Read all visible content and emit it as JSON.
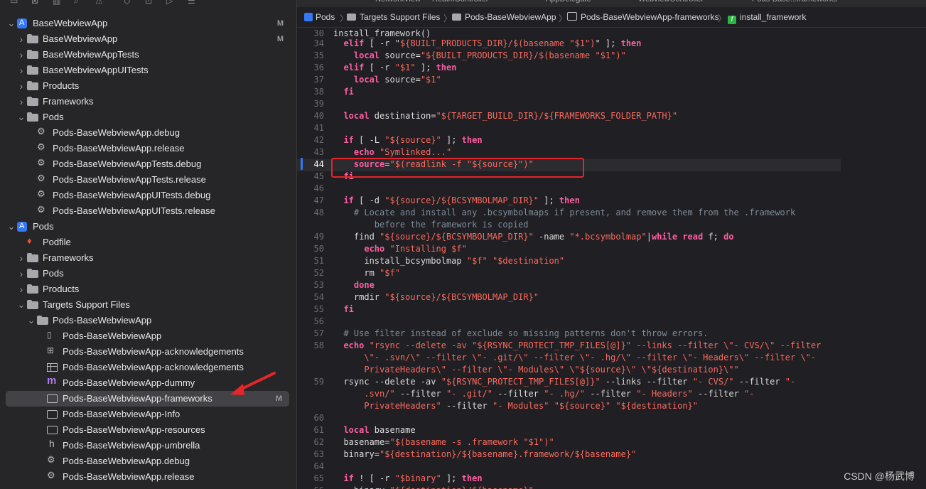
{
  "top_partial": {
    "tabs": [
      "NetworkView",
      "RealmController",
      "AppDelegate",
      "WebviewController",
      "Pods-Base...frameworks"
    ]
  },
  "navigator": {
    "items": [
      {
        "label": "BaseWebviewApp",
        "depth": 0,
        "kind": "project",
        "expanded": true,
        "badge": "M"
      },
      {
        "label": "BaseWebviewApp",
        "depth": 1,
        "kind": "folder",
        "expanded": false,
        "badge": "M"
      },
      {
        "label": "BaseWebviewAppTests",
        "depth": 1,
        "kind": "folder",
        "expanded": false
      },
      {
        "label": "BaseWebviewAppUITests",
        "depth": 1,
        "kind": "folder",
        "expanded": false
      },
      {
        "label": "Products",
        "depth": 1,
        "kind": "folder",
        "expanded": false
      },
      {
        "label": "Frameworks",
        "depth": 1,
        "kind": "folder",
        "expanded": false
      },
      {
        "label": "Pods",
        "depth": 1,
        "kind": "folder",
        "expanded": true
      },
      {
        "label": "Pods-BaseWebviewApp.debug",
        "depth": 2,
        "kind": "xcconfig"
      },
      {
        "label": "Pods-BaseWebviewApp.release",
        "depth": 2,
        "kind": "xcconfig"
      },
      {
        "label": "Pods-BaseWebviewAppTests.debug",
        "depth": 2,
        "kind": "xcconfig"
      },
      {
        "label": "Pods-BaseWebviewAppTests.release",
        "depth": 2,
        "kind": "xcconfig"
      },
      {
        "label": "Pods-BaseWebviewAppUITests.debug",
        "depth": 2,
        "kind": "xcconfig"
      },
      {
        "label": "Pods-BaseWebviewAppUITests.release",
        "depth": 2,
        "kind": "xcconfig"
      },
      {
        "label": "Pods",
        "depth": 0,
        "kind": "project",
        "expanded": true
      },
      {
        "label": "Podfile",
        "depth": 1,
        "kind": "podfile"
      },
      {
        "label": "Frameworks",
        "depth": 1,
        "kind": "folder",
        "expanded": false
      },
      {
        "label": "Pods",
        "depth": 1,
        "kind": "folder",
        "expanded": false
      },
      {
        "label": "Products",
        "depth": 1,
        "kind": "folder",
        "expanded": false
      },
      {
        "label": "Targets Support Files",
        "depth": 1,
        "kind": "folder",
        "expanded": true
      },
      {
        "label": "Pods-BaseWebviewApp",
        "depth": 2,
        "kind": "folder",
        "expanded": true
      },
      {
        "label": "Pods-BaseWebviewApp",
        "depth": 3,
        "kind": "modulemap"
      },
      {
        "label": "Pods-BaseWebviewApp-acknowledgements",
        "depth": 3,
        "kind": "markdown"
      },
      {
        "label": "Pods-BaseWebviewApp-acknowledgements",
        "depth": 3,
        "kind": "plist"
      },
      {
        "label": "Pods-BaseWebviewApp-dummy",
        "depth": 3,
        "kind": "objc"
      },
      {
        "label": "Pods-BaseWebviewApp-frameworks",
        "depth": 3,
        "kind": "script",
        "selected": true,
        "badge": "M"
      },
      {
        "label": "Pods-BaseWebviewApp-Info",
        "depth": 3,
        "kind": "script"
      },
      {
        "label": "Pods-BaseWebviewApp-resources",
        "depth": 3,
        "kind": "script"
      },
      {
        "label": "Pods-BaseWebviewApp-umbrella",
        "depth": 3,
        "kind": "header"
      },
      {
        "label": "Pods-BaseWebviewApp.debug",
        "depth": 3,
        "kind": "xcconfig"
      },
      {
        "label": "Pods-BaseWebviewApp.release",
        "depth": 3,
        "kind": "xcconfig"
      }
    ]
  },
  "jumpbar": {
    "crumbs": [
      "Pods",
      "Targets Support Files",
      "Pods-BaseWebviewApp",
      "Pods-BaseWebviewApp-frameworks",
      "install_framework"
    ]
  },
  "editor": {
    "sticky": {
      "num": "30",
      "text": "install_framework()"
    },
    "current_line": "44",
    "lines": [
      {
        "num": "34",
        "segs": [
          [
            "",
            "  "
          ],
          [
            "kw",
            "elif"
          ],
          [
            "",
            " [ -r \""
          ],
          [
            "str",
            "${BUILT_PRODUCTS_DIR}/$(basename \"$1\")"
          ],
          [
            "",
            "\" ]; "
          ],
          [
            "kw",
            "then"
          ]
        ]
      },
      {
        "num": "35",
        "segs": [
          [
            "",
            "    "
          ],
          [
            "kw",
            "local"
          ],
          [
            "",
            " source="
          ],
          [
            "str",
            "\"${BUILT_PRODUCTS_DIR}/$(basename \"$1\")\""
          ]
        ]
      },
      {
        "num": "36",
        "segs": [
          [
            "",
            "  "
          ],
          [
            "kw",
            "elif"
          ],
          [
            "",
            " [ -r "
          ],
          [
            "str",
            "\"$1\""
          ],
          [
            "",
            " ]; "
          ],
          [
            "kw",
            "then"
          ]
        ]
      },
      {
        "num": "37",
        "segs": [
          [
            "",
            "    "
          ],
          [
            "kw",
            "local"
          ],
          [
            "",
            " source="
          ],
          [
            "str",
            "\"$1\""
          ]
        ]
      },
      {
        "num": "38",
        "segs": [
          [
            "",
            "  "
          ],
          [
            "kw",
            "fi"
          ]
        ]
      },
      {
        "num": "39",
        "segs": []
      },
      {
        "num": "40",
        "segs": [
          [
            "",
            "  "
          ],
          [
            "kw",
            "local"
          ],
          [
            "",
            " destination="
          ],
          [
            "str",
            "\"${TARGET_BUILD_DIR}/${FRAMEWORKS_FOLDER_PATH}\""
          ]
        ]
      },
      {
        "num": "41",
        "segs": []
      },
      {
        "num": "42",
        "segs": [
          [
            "",
            "  "
          ],
          [
            "kw",
            "if"
          ],
          [
            "",
            " [ -L "
          ],
          [
            "str",
            "\"${source}\""
          ],
          [
            "",
            " ]; "
          ],
          [
            "kw",
            "then"
          ]
        ]
      },
      {
        "num": "43",
        "segs": [
          [
            "",
            "    "
          ],
          [
            "kw",
            "echo"
          ],
          [
            "",
            " "
          ],
          [
            "str",
            "\"Symlinked...\""
          ]
        ]
      },
      {
        "num": "44",
        "segs": [
          [
            "",
            "    "
          ],
          [
            "kw",
            "source"
          ],
          [
            "",
            "="
          ],
          [
            "str",
            "\"$(readlink -f \"${source}\")\""
          ]
        ]
      },
      {
        "num": "45",
        "segs": [
          [
            "",
            "  "
          ],
          [
            "kw",
            "fi"
          ]
        ]
      },
      {
        "num": "46",
        "segs": []
      },
      {
        "num": "47",
        "segs": [
          [
            "",
            "  "
          ],
          [
            "kw",
            "if"
          ],
          [
            "",
            " [ -d "
          ],
          [
            "str",
            "\"${source}/${BCSYMBOLMAP_DIR}\""
          ],
          [
            "",
            " ]; "
          ],
          [
            "kw",
            "then"
          ]
        ]
      },
      {
        "num": "48",
        "segs": [
          [
            "cmt",
            "    # Locate and install any .bcsymbolmaps if present, and remove them from the .framework"
          ]
        ]
      },
      {
        "num": "",
        "segs": [
          [
            "cmt",
            "        before the framework is copied"
          ]
        ]
      },
      {
        "num": "49",
        "segs": [
          [
            "",
            "    find "
          ],
          [
            "str",
            "\"${source}/${BCSYMBOLMAP_DIR}\""
          ],
          [
            "",
            " -name "
          ],
          [
            "str",
            "\"*.bcsymbolmap\""
          ],
          [
            "",
            "|"
          ],
          [
            "kw",
            "while"
          ],
          [
            "",
            " "
          ],
          [
            "kw",
            "read"
          ],
          [
            "",
            " f; "
          ],
          [
            "kw",
            "do"
          ]
        ]
      },
      {
        "num": "50",
        "segs": [
          [
            "",
            "      "
          ],
          [
            "kw",
            "echo"
          ],
          [
            "",
            " "
          ],
          [
            "str",
            "\"Installing $f\""
          ]
        ]
      },
      {
        "num": "51",
        "segs": [
          [
            "",
            "      install_bcsymbolmap "
          ],
          [
            "str",
            "\"$f\""
          ],
          [
            "",
            " "
          ],
          [
            "str",
            "\"$destination\""
          ]
        ]
      },
      {
        "num": "52",
        "segs": [
          [
            "",
            "      rm "
          ],
          [
            "str",
            "\"$f\""
          ]
        ]
      },
      {
        "num": "53",
        "segs": [
          [
            "",
            "    "
          ],
          [
            "kw",
            "done"
          ]
        ]
      },
      {
        "num": "54",
        "segs": [
          [
            "",
            "    rmdir "
          ],
          [
            "str",
            "\"${source}/${BCSYMBOLMAP_DIR}\""
          ]
        ]
      },
      {
        "num": "55",
        "segs": [
          [
            "",
            "  "
          ],
          [
            "kw",
            "fi"
          ]
        ]
      },
      {
        "num": "56",
        "segs": []
      },
      {
        "num": "57",
        "segs": [
          [
            "cmt",
            "  # Use filter instead of exclude so missing patterns don't throw errors."
          ]
        ]
      },
      {
        "num": "58",
        "segs": [
          [
            "",
            "  "
          ],
          [
            "kw",
            "echo"
          ],
          [
            "",
            " "
          ],
          [
            "str",
            "\"rsync --delete -av \"${RSYNC_PROTECT_TMP_FILES[@]}\" --links --filter \\\"- CVS/\\\" --filter"
          ]
        ]
      },
      {
        "num": "",
        "segs": [
          [
            "str",
            "      \\\"- .svn/\\\" --filter \\\"- .git/\\\" --filter \\\"- .hg/\\\" --filter \\\"- Headers\\\" --filter \\\"-"
          ]
        ]
      },
      {
        "num": "",
        "segs": [
          [
            "str",
            "      PrivateHeaders\\\" --filter \\\"- Modules\\\" \\\"${source}\\\" \\\"${destination}\\\"\""
          ]
        ]
      },
      {
        "num": "59",
        "segs": [
          [
            "",
            "  rsync --delete -av "
          ],
          [
            "str",
            "\"${RSYNC_PROTECT_TMP_FILES[@]}\""
          ],
          [
            "",
            " --links --filter "
          ],
          [
            "str",
            "\"- CVS/\""
          ],
          [
            "",
            " --filter "
          ],
          [
            "str",
            "\"-"
          ]
        ]
      },
      {
        "num": "",
        "segs": [
          [
            "str",
            "      .svn/\""
          ],
          [
            "",
            " --filter "
          ],
          [
            "str",
            "\"- .git/\""
          ],
          [
            "",
            " --filter "
          ],
          [
            "str",
            "\"- .hg/\""
          ],
          [
            "",
            " --filter "
          ],
          [
            "str",
            "\"- Headers\""
          ],
          [
            "",
            " --filter "
          ],
          [
            "str",
            "\"-"
          ]
        ]
      },
      {
        "num": "",
        "segs": [
          [
            "str",
            "      PrivateHeaders\""
          ],
          [
            "",
            " --filter "
          ],
          [
            "str",
            "\"- Modules\""
          ],
          [
            "",
            " "
          ],
          [
            "str",
            "\"${source}\""
          ],
          [
            "",
            " "
          ],
          [
            "str",
            "\"${destination}\""
          ]
        ]
      },
      {
        "num": "60",
        "segs": []
      },
      {
        "num": "61",
        "segs": [
          [
            "",
            "  "
          ],
          [
            "kw",
            "local"
          ],
          [
            "",
            " basename"
          ]
        ]
      },
      {
        "num": "62",
        "segs": [
          [
            "",
            "  basename="
          ],
          [
            "str",
            "\"$(basename -s .framework \"$1\")\""
          ]
        ]
      },
      {
        "num": "63",
        "segs": [
          [
            "",
            "  binary="
          ],
          [
            "str",
            "\"${destination}/${basename}.framework/${basename}\""
          ]
        ]
      },
      {
        "num": "64",
        "segs": []
      },
      {
        "num": "65",
        "segs": [
          [
            "",
            "  "
          ],
          [
            "kw",
            "if"
          ],
          [
            "",
            " ! [ -r "
          ],
          [
            "str",
            "\"$binary\""
          ],
          [
            "",
            " ]; "
          ],
          [
            "kw",
            "then"
          ]
        ]
      },
      {
        "num": "66",
        "segs": [
          [
            "",
            "    binary="
          ],
          [
            "str",
            "\"${destination}/${basename}\""
          ]
        ]
      }
    ]
  },
  "watermark": "CSDN @杨武博",
  "colors": {
    "keyword": "#fc5fa3",
    "string": "#fc6a5d",
    "comment": "#7f8c98",
    "annotation_box": "#e3262b",
    "annotation_arrow": "#e3262b"
  }
}
